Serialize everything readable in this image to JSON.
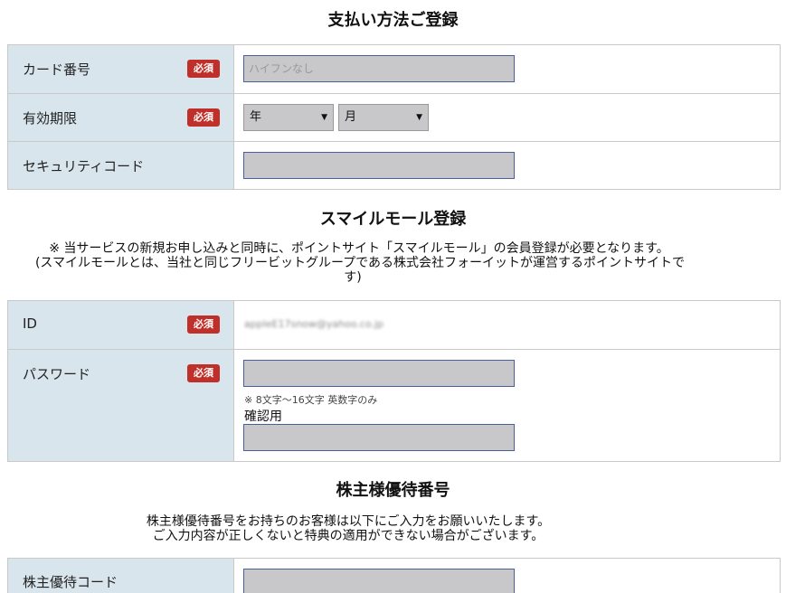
{
  "payment": {
    "title": "支払い方法ご登録",
    "card_number_label": "カード番号",
    "card_number_placeholder": "ハイフンなし",
    "expiry_label": "有効期限",
    "year_select": "年",
    "month_select": "月",
    "security_code_label": "セキュリティコード",
    "required_badge": "必須"
  },
  "smile": {
    "title": "スマイルモール登録",
    "note_line1": "※ 当サービスの新規お申し込みと同時に、ポイントサイト「スマイルモール」の会員登録が必要となります。",
    "note_line2": "(スマイルモールとは、当社と同じフリービットグループである株式会社フォーイットが運営するポイントサイトで",
    "note_line3": "す)",
    "id_label": "ID",
    "id_value": "appleE17snow@yahoo.co.jp",
    "password_label": "パスワード",
    "password_hint": "※ 8文字〜16文字 英数字のみ",
    "confirm_label": "確認用",
    "required_badge": "必須"
  },
  "shareholder": {
    "title": "株主様優待番号",
    "note_line1": "株主様優待番号をお持ちのお客様は以下にご入力をお願いいたします。",
    "note_line2": "ご入力内容が正しくないと特典の適用ができない場合がございます。",
    "code_label": "株主優待コード"
  }
}
